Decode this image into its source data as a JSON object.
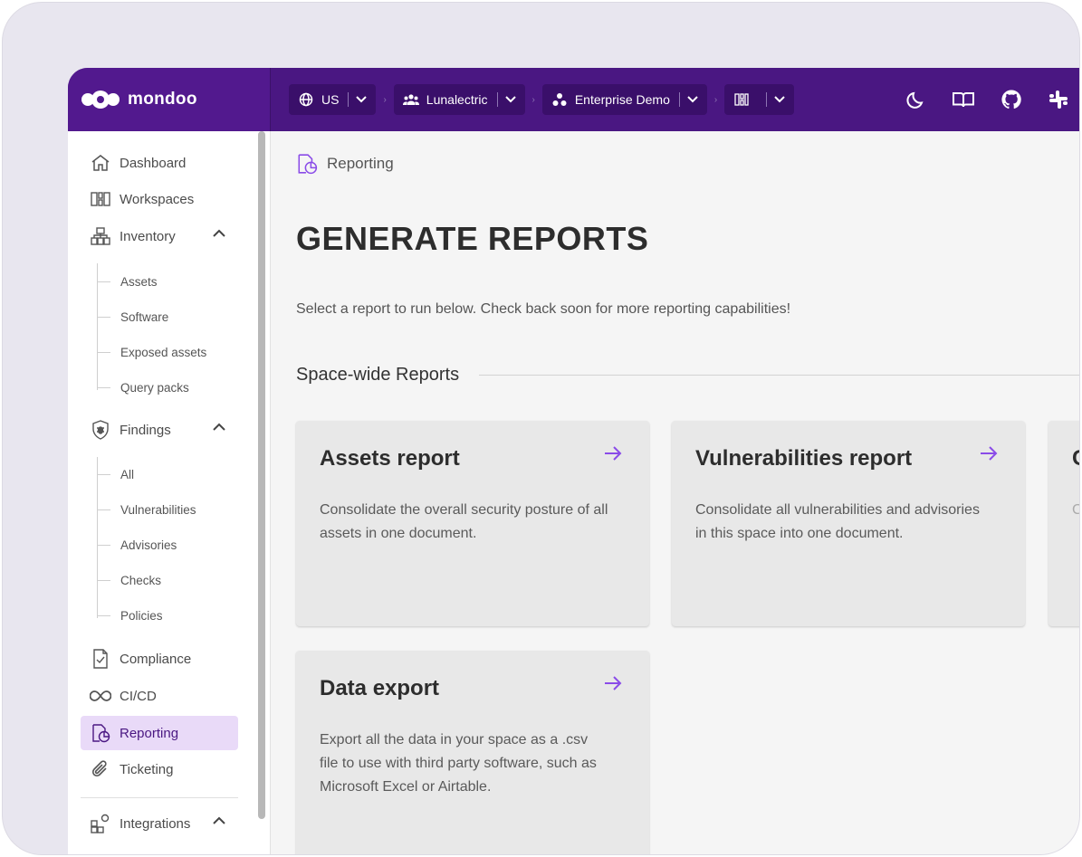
{
  "brand": {
    "name": "mondoo"
  },
  "topbar": {
    "region": "US",
    "organization": "Lunalectric",
    "space": "Enterprise Demo",
    "workspace": "",
    "icons": [
      "moon-icon",
      "book-icon",
      "github-icon",
      "slack-icon"
    ]
  },
  "sidebar": {
    "items": [
      {
        "label": "Dashboard",
        "icon": "home-icon"
      },
      {
        "label": "Workspaces",
        "icon": "workspaces-icon"
      },
      {
        "label": "Inventory",
        "icon": "inventory-icon",
        "expanded": true,
        "children": [
          "Assets",
          "Software",
          "Exposed assets",
          "Query packs"
        ]
      },
      {
        "label": "Findings",
        "icon": "shield-bug-icon",
        "expanded": true,
        "children": [
          "All",
          "Vulnerabilities",
          "Advisories",
          "Checks",
          "Policies"
        ]
      },
      {
        "label": "Compliance",
        "icon": "compliance-icon"
      },
      {
        "label": "CI/CD",
        "icon": "infinity-icon"
      },
      {
        "label": "Reporting",
        "icon": "reporting-icon",
        "active": true
      },
      {
        "label": "Ticketing",
        "icon": "paperclip-icon"
      },
      {
        "label": "Integrations",
        "icon": "integrations-icon",
        "expanded": true
      }
    ]
  },
  "main": {
    "breadcrumb": "Reporting",
    "title": "GENERATE REPORTS",
    "description": "Select a report to run below. Check back soon for more reporting capabilities!",
    "section_title": "Space-wide Reports",
    "cards": [
      {
        "title": "Assets report",
        "description": "Consolidate the overall security posture of all assets in one document."
      },
      {
        "title": "Vulnerabilities report",
        "description": "Consolidate all vulnerabilities and advisories in this space into one document."
      },
      {
        "title": "C",
        "description": "C"
      },
      {
        "title": "Data export",
        "description": "Export all the data in your space as a .csv file to use with third party software, such as Microsoft Excel or Airtable."
      }
    ]
  },
  "colors": {
    "brand": "#4a1782",
    "accent": "#8a4be8",
    "active_bg": "#e9daf8"
  }
}
